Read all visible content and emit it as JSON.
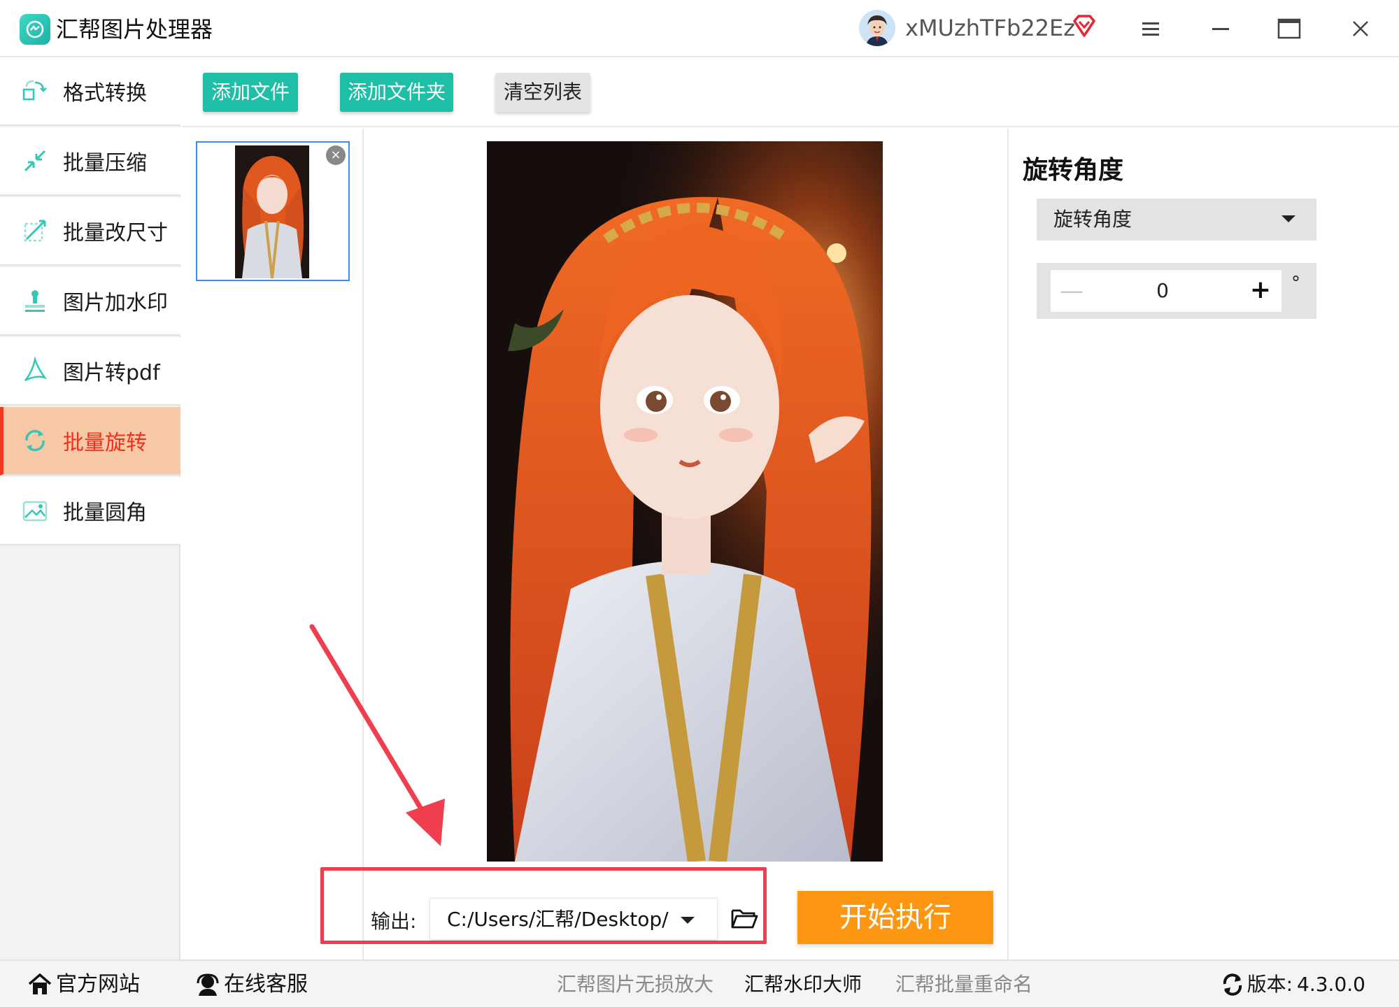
{
  "app": {
    "title": "汇帮图片处理器",
    "username": "xMUzhTFb22Ez",
    "avatar": "user-avatar",
    "vip_icon": "vip-diamond-icon"
  },
  "window_controls": [
    "menu-icon",
    "minimize-icon",
    "maximize-icon",
    "close-icon"
  ],
  "sidebar": {
    "items": [
      {
        "label": "格式转换",
        "icon": "format-convert-icon",
        "active": false
      },
      {
        "label": "批量压缩",
        "icon": "compress-icon",
        "active": false
      },
      {
        "label": "批量改尺寸",
        "icon": "resize-icon",
        "active": false
      },
      {
        "label": "图片加水印",
        "icon": "watermark-icon",
        "active": false
      },
      {
        "label": "图片转pdf",
        "icon": "pdf-icon",
        "active": false
      },
      {
        "label": "批量旋转",
        "icon": "rotate-icon",
        "active": true
      },
      {
        "label": "批量圆角",
        "icon": "rounded-corner-icon",
        "active": false
      }
    ]
  },
  "toolbar": {
    "add_file": "添加文件",
    "add_folder": "添加文件夹",
    "clear_list": "清空列表"
  },
  "thumbnail": {
    "close_symbol": "×"
  },
  "settings": {
    "title": "旋转角度",
    "select_value": "旋转角度",
    "stepper": {
      "minus": "—",
      "value": "0",
      "plus": "+",
      "unit": "°"
    }
  },
  "output": {
    "label": "输出:",
    "path": "C:/Users/汇帮/Desktop/",
    "start_button": "开始执行"
  },
  "footer": {
    "official_site": "官方网站",
    "online_service": "在线客服",
    "links": [
      "汇帮图片无损放大",
      "汇帮水印大师",
      "汇帮批量重命名"
    ],
    "version_label": "版本:",
    "version_value": "4.3.0.0"
  },
  "colors": {
    "accent_green": "#1fbea6",
    "active_nav": "#f7c9a6",
    "active_text": "#f0301c",
    "start_orange": "#fd9611",
    "annotation_red": "#ef3e4e"
  }
}
